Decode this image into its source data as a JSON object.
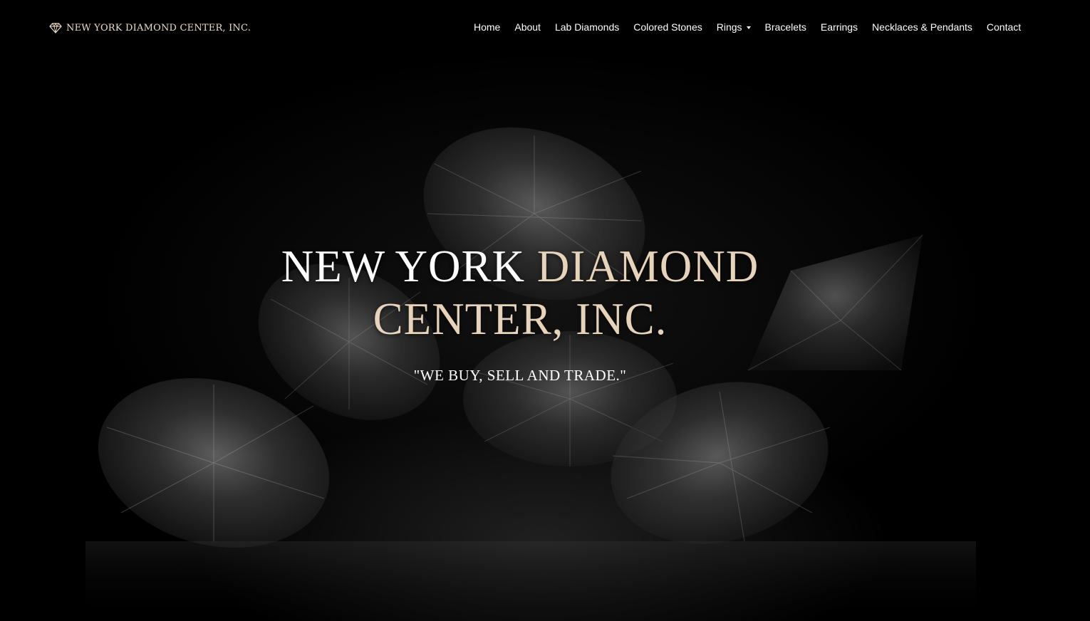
{
  "brand": {
    "name": "NEW YORK DIAMOND CENTER, INC.",
    "icon": "diamond-icon",
    "color": "#e9dcc8"
  },
  "nav": {
    "items": [
      {
        "label": "Home"
      },
      {
        "label": "About"
      },
      {
        "label": "Lab Diamonds"
      },
      {
        "label": "Colored Stones"
      },
      {
        "label": "Rings",
        "dropdown": true,
        "icon": "caret-down-icon"
      },
      {
        "label": "Bracelets"
      },
      {
        "label": "Earrings"
      },
      {
        "label": "Necklaces & Pendants"
      },
      {
        "label": "Contact"
      }
    ]
  },
  "hero": {
    "title_part1": "NEW YORK ",
    "title_part2": "DIAMOND",
    "title_line2": "CENTER, INC.",
    "tagline": "\"WE BUY, SELL AND TRADE.\"",
    "accent_color": "#e6d3b9",
    "background_image": "diamonds-on-black"
  }
}
